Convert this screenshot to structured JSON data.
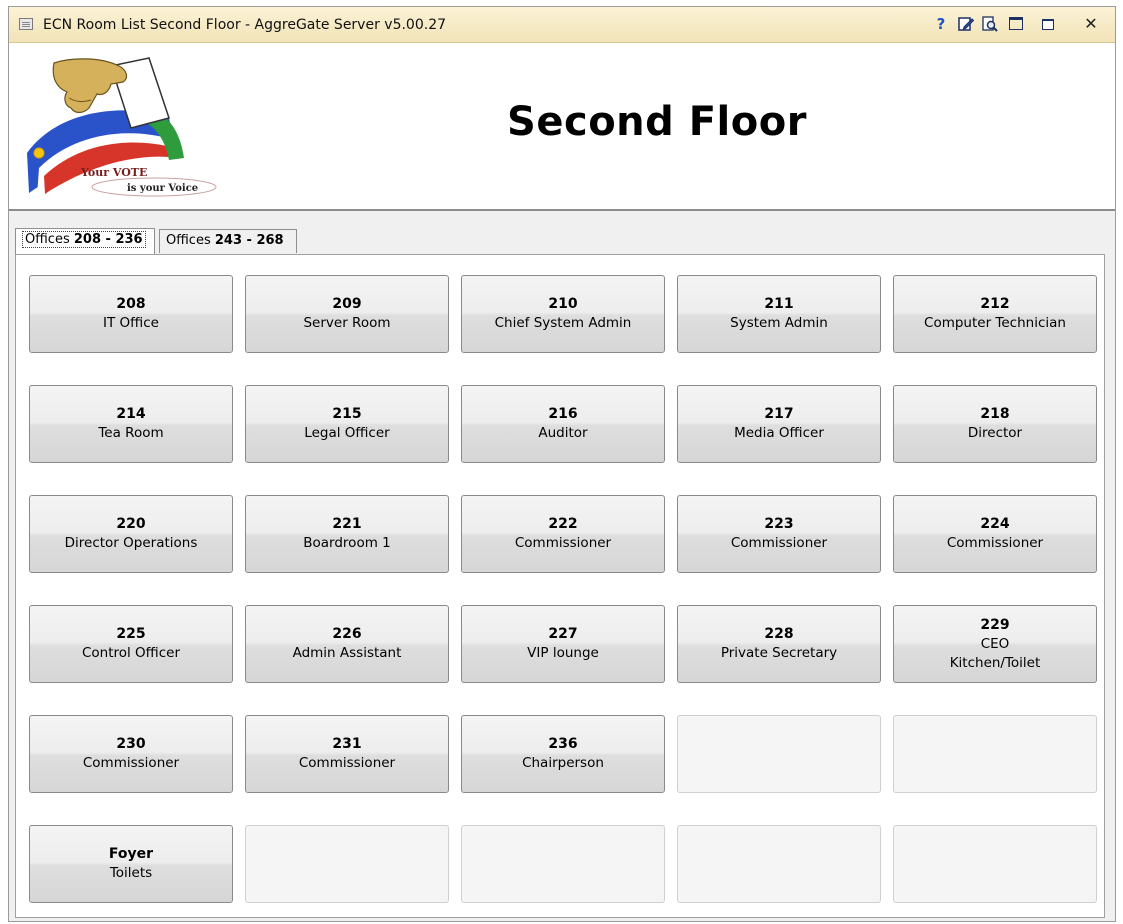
{
  "window": {
    "title": "ECN Room List Second Floor - AggreGate Server v5.00.27",
    "buttons": {
      "help": "?",
      "close": "✕"
    }
  },
  "header": {
    "title": "Second Floor",
    "logo": {
      "line1": "Your VOTE",
      "line2": "is your Voice"
    }
  },
  "tabs": [
    {
      "prefix": "Offices ",
      "range": "208 - 236",
      "active": true
    },
    {
      "prefix": "Offices ",
      "range": "243 - 268",
      "active": false
    }
  ],
  "rooms": [
    {
      "number": "208",
      "name": "IT Office"
    },
    {
      "number": "209",
      "name": "Server Room"
    },
    {
      "number": "210",
      "name": "Chief System Admin"
    },
    {
      "number": "211",
      "name": "System Admin"
    },
    {
      "number": "212",
      "name": "Computer Technician"
    },
    {
      "number": "214",
      "name": "Tea Room"
    },
    {
      "number": "215",
      "name": "Legal Officer"
    },
    {
      "number": "216",
      "name": "Auditor"
    },
    {
      "number": "217",
      "name": "Media Officer"
    },
    {
      "number": "218",
      "name": "Director"
    },
    {
      "number": "220",
      "name": "Director Operations"
    },
    {
      "number": "221",
      "name": "Boardroom 1"
    },
    {
      "number": "222",
      "name": "Commissioner"
    },
    {
      "number": "223",
      "name": "Commissioner"
    },
    {
      "number": "224",
      "name": "Commissioner"
    },
    {
      "number": "225",
      "name": "Control Officer"
    },
    {
      "number": "226",
      "name": "Admin Assistant"
    },
    {
      "number": "227",
      "name": "VIP lounge"
    },
    {
      "number": "228",
      "name": "Private Secretary"
    },
    {
      "number": "229",
      "name": "CEO",
      "name2": "Kitchen/Toilet"
    },
    {
      "number": "230",
      "name": "Commissioner"
    },
    {
      "number": "231",
      "name": "Commissioner"
    },
    {
      "number": "236",
      "name": "Chairperson"
    },
    {
      "number": "Foyer",
      "name": "Toilets"
    }
  ]
}
